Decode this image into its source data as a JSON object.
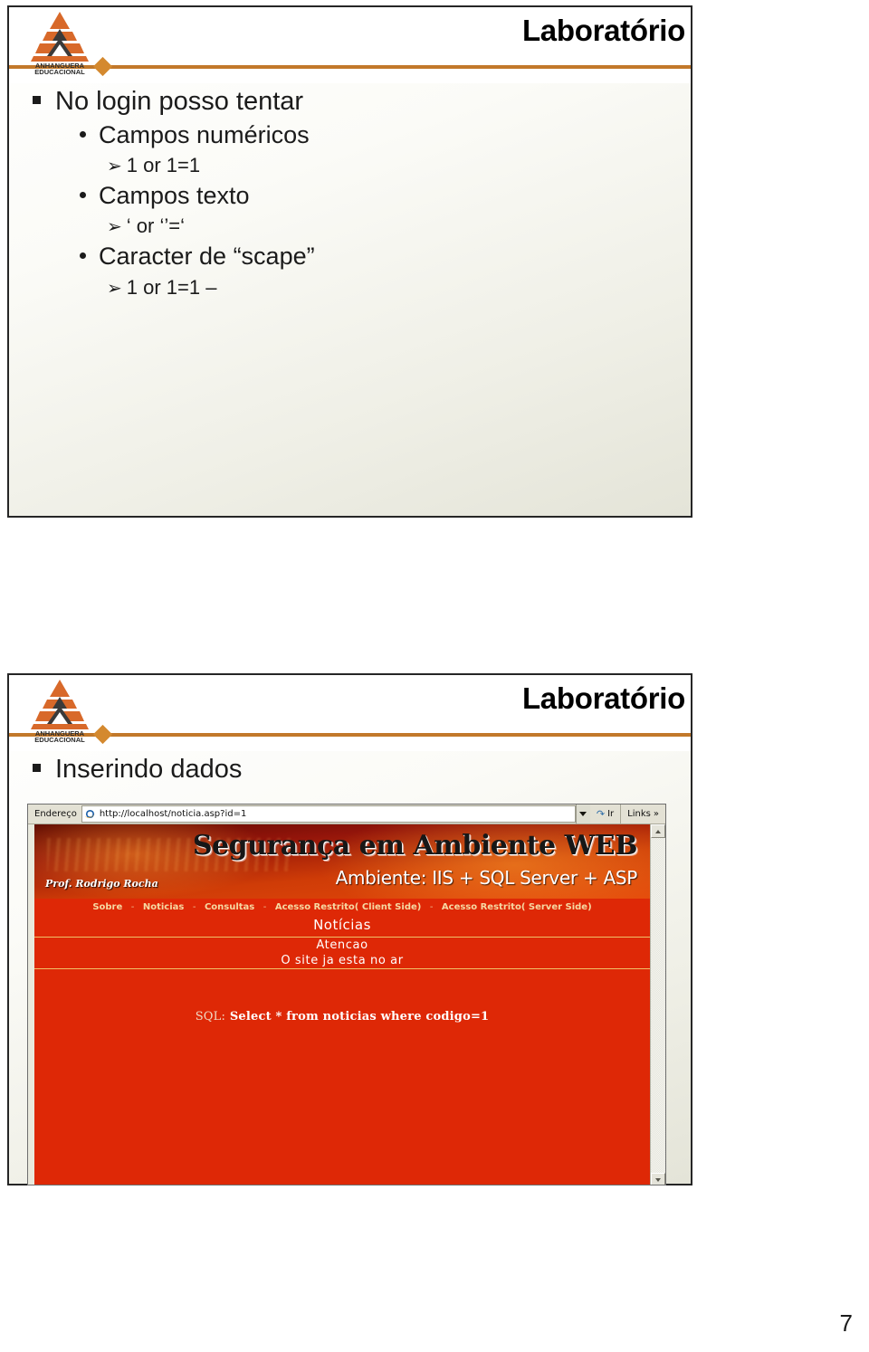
{
  "deck": {
    "page_number": "7"
  },
  "slide1": {
    "logo_line1": "ANHANGUERA",
    "logo_line2": "EDUCACIONAL",
    "title": "Laboratório",
    "bullets": {
      "b1": "No login posso tentar",
      "b2": "Campos numéricos",
      "b3": "1 or 1=1",
      "b4": "Campos texto",
      "b5": "‘ or ‘’=‘",
      "b6": "Caracter de “scape”",
      "b7": "1 or 1=1 –",
      "arrow_glyph": "➢"
    }
  },
  "slide2": {
    "logo_line1": "ANHANGUERA",
    "logo_line2": "EDUCACIONAL",
    "title": "Laboratório",
    "bullets": {
      "b1": "Inserindo dados"
    },
    "browser": {
      "address_label": "Endereço",
      "url": "http://localhost/noticia.asp?id=1",
      "url_placeholder": "http://",
      "go_label": "Ir",
      "links_label": "Links",
      "links_chevron": "»",
      "page": {
        "banner_title": "Segurança em Ambiente WEB",
        "banner_subtitle": "Ambiente: IIS + SQL Server + ASP",
        "author": "Prof. Rodrigo Rocha",
        "nav": [
          "Sobre",
          "Noticias",
          "Consultas",
          "Acesso Restrito( Client Side)",
          "Acesso Restrito( Server Side)"
        ],
        "nav_separator": "-",
        "section_title": "Notícias",
        "notice_title": "Atencao",
        "notice_text": "O site ja esta no ar",
        "sql_label": "SQL:",
        "sql_statement": "Select * from noticias where codigo=1"
      }
    }
  },
  "colors": {
    "accent_orange": "#c2782a",
    "page_red": "#de2806",
    "slide_border": "#262626",
    "logo_orange": "#d8692a",
    "logo_dark": "#3a3a3a"
  }
}
